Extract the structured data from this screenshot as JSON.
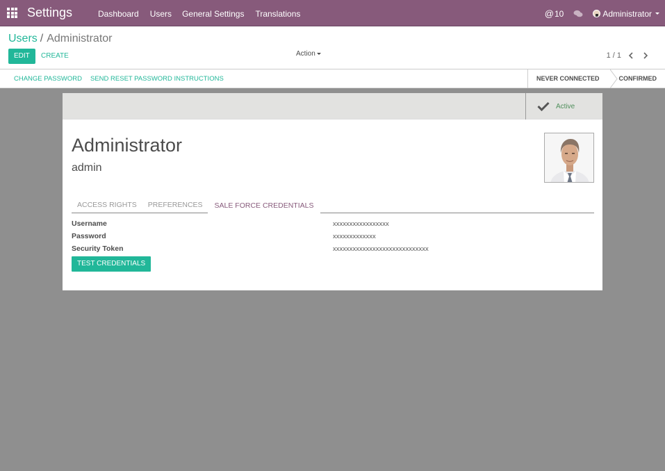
{
  "navbar": {
    "brand": "Settings",
    "menu": [
      "Dashboard",
      "Users",
      "General Settings",
      "Translations"
    ],
    "mention_count": "10",
    "user_name": "Administrator"
  },
  "control_panel": {
    "breadcrumb_parent": "Users",
    "breadcrumb_separator": "/",
    "breadcrumb_current": "Administrator",
    "edit_label": "EDIT",
    "create_label": "CREATE",
    "action_label": "Action",
    "pager": "1 / 1"
  },
  "statusbar": {
    "buttons": [
      "CHANGE PASSWORD",
      "SEND RESET PASSWORD INSTRUCTIONS"
    ],
    "steps": [
      "NEVER CONNECTED",
      "CONFIRMED"
    ]
  },
  "sheet": {
    "active_label": "Active",
    "name": "Administrator",
    "login": "admin",
    "tabs": [
      "ACCESS RIGHTS",
      "PREFERENCES",
      "SALE FORCE CREDENTIALS"
    ],
    "fields": [
      {
        "label": "Username",
        "value": "xxxxxxxxxxxxxxxxx"
      },
      {
        "label": "Password",
        "value": "xxxxxxxxxxxxx"
      },
      {
        "label": "Security Token",
        "value": "xxxxxxxxxxxxxxxxxxxxxxxxxxxxx"
      }
    ],
    "test_button": "TEST CREDENTIALS"
  },
  "colors": {
    "brand_purple": "#875a7b",
    "accent_teal": "#21b799",
    "backdrop": "#8f8f8f"
  }
}
